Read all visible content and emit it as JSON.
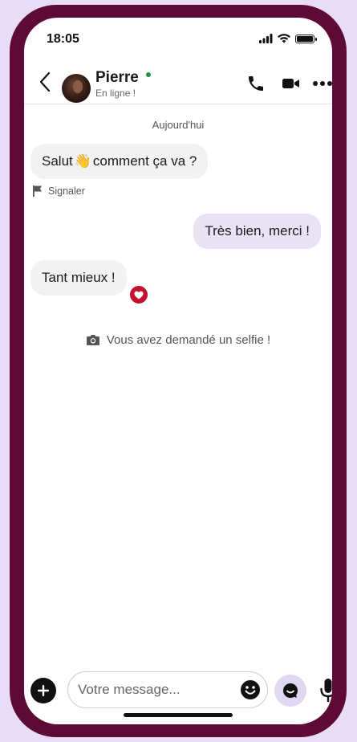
{
  "status_bar": {
    "time": "18:05"
  },
  "header": {
    "contact_name": "Pierre",
    "contact_status": "En ligne !",
    "icons": [
      "back-icon",
      "phone-icon",
      "video-icon",
      "more-icon"
    ]
  },
  "conversation": {
    "date_label": "Aujourd'hui",
    "messages": [
      {
        "direction": "incoming",
        "text_before": "Salut",
        "emoji": "👋",
        "text_after": "comment ça va ?"
      },
      {
        "direction": "outgoing",
        "text": "Très bien, merci !"
      },
      {
        "direction": "incoming",
        "text": "Tant mieux !",
        "reaction": "heart-icon"
      }
    ],
    "report_label": "Signaler",
    "system_message": "Vous avez demandé un selfie !"
  },
  "composer": {
    "placeholder": "Votre message..."
  },
  "colors": {
    "phone_frame": "#5e0a36",
    "background": "#e8dcf7",
    "outgoing_bubble": "#e9e2f5",
    "incoming_bubble": "#f2f2f2",
    "heart": "#c4122e",
    "online": "#1f8f4e"
  }
}
